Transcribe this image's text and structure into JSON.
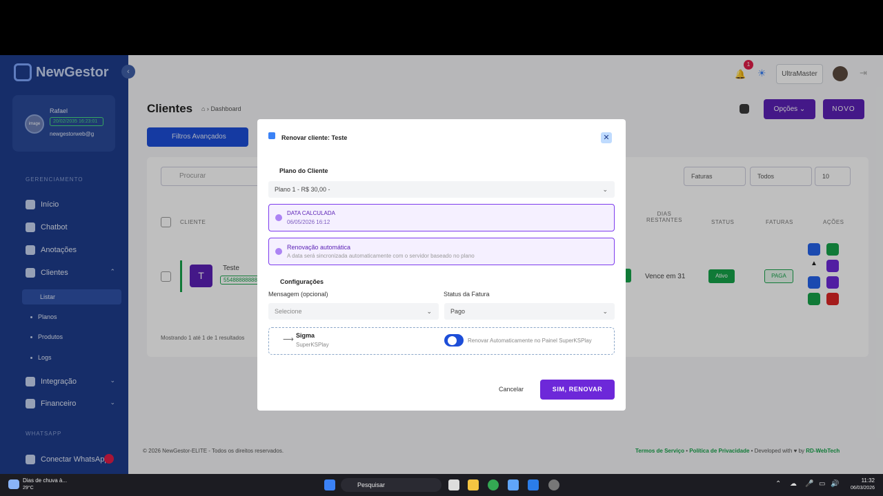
{
  "sidebar": {
    "logo": "NewGestor",
    "collapse_icon": "chevron-left-icon",
    "user": {
      "avatar_text": "image",
      "name": "Rafael",
      "expiry": "20/02/2035 16:23:01",
      "email": "newgestorweb@g"
    },
    "section_manage": "GERENCIAMENTO",
    "nav": {
      "inicio": "Início",
      "chatbot": "Chatbot",
      "anotacoes": "Anotações",
      "clientes": "Clientes",
      "integracao": "Integração",
      "financeiro": "Financeiro"
    },
    "sub": {
      "listar": "Listar",
      "planos": "Planos",
      "produtos": "Produtos",
      "logs": "Logs"
    },
    "section_whatsapp": "WHATSAPP",
    "whatsapp": "Conectar WhatsApp"
  },
  "header": {
    "bell_count": "1",
    "profile_select": "UltraMaster"
  },
  "page": {
    "title": "Clientes",
    "breadcrumb": "Dashboard",
    "options_btn": "Opções",
    "new_btn": "NOVO",
    "filters_btn": "Filtros Avançados"
  },
  "table": {
    "search_placeholder": "Procurar",
    "filter_faturas": "Faturas",
    "filter_todos": "Todos",
    "per_page": "10",
    "headers": {
      "cliente": "CLIENTE",
      "dias": "DIAS",
      "restantes": "RESTANTES",
      "status": "STATUS",
      "faturas": "FATURAS",
      "acoes": "AÇÕES"
    },
    "row": {
      "avatar": "T",
      "name": "Teste",
      "phone": "55488888888",
      "vence": "Vence em 31",
      "status": "Ativo",
      "fatura": "PAGA"
    },
    "showing": "Mostrando 1 até 1 de 1 resultados"
  },
  "footer": {
    "copyright": "© 2026 NewGestor-ELITE - Todos os direitos reservados.",
    "terms": "Termos de Serviço",
    "privacy": "Política de Privacidade",
    "dev": "Developed with",
    "by": "by",
    "company": "RD-WebTech"
  },
  "modal": {
    "title": "Renovar cliente: Teste",
    "plan_label": "Plano do Cliente",
    "plan_value": "Plano 1 - R$ 30,00 -",
    "calc_label": "DATA CALCULADA",
    "calc_value": "06/05/2026 16:12",
    "auto_label": "Renovação automática",
    "auto_desc": "A data será sincronizada automaticamente com o servidor baseado no plano",
    "config_label": "Configurações",
    "msg_label": "Mensagem (opcional)",
    "msg_value": "Selecione",
    "status_label": "Status da Fatura",
    "status_value": "Pago",
    "panel_name": "Sigma",
    "panel_sub": "SuperKSPlay",
    "switch_label": "Renovar Automaticamente no Painel SuperKSPlay",
    "cancel": "Cancelar",
    "confirm": "SIM, RENOVAR"
  },
  "taskbar": {
    "weather_title": "Dias de chuva à...",
    "weather_temp": "29°C",
    "search": "Pesquisar",
    "time": "11:32",
    "date": "06/03/2026"
  }
}
